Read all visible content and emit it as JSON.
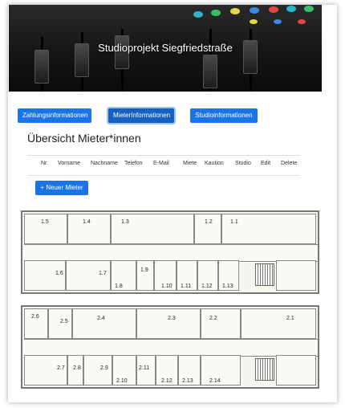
{
  "banner": {
    "title": "Studioprojekt Siegfriedstraße"
  },
  "nav": {
    "payments_label": "Zahlungsinformationen",
    "tenants_label": "MieterInformationen",
    "studios_label": "Studioinformationen"
  },
  "overview": {
    "title": "Übersicht Mieter*innen",
    "columns": [
      "Nr.",
      "Vorname",
      "Nachname",
      "Telefon",
      "E-Mail",
      "Miete",
      "Kaution",
      "Studio",
      "Edit",
      "Delete"
    ],
    "new_tenant_label": "+ Neuer Mieter"
  },
  "floorplan": {
    "upper_rooms": [
      "1.5",
      "1.4",
      "1.3",
      "1.2",
      "1.1",
      "1.6",
      "1.7",
      "1.8",
      "1.9",
      "1.10",
      "1.11",
      "1.12",
      "1.13"
    ],
    "lower_rooms": [
      "2.6",
      "2.5",
      "2.4",
      "2.3",
      "2.2",
      "2.1",
      "2.7",
      "2.8",
      "2.9",
      "2.10",
      "2.11",
      "2.12",
      "2.13",
      "2.14"
    ]
  }
}
